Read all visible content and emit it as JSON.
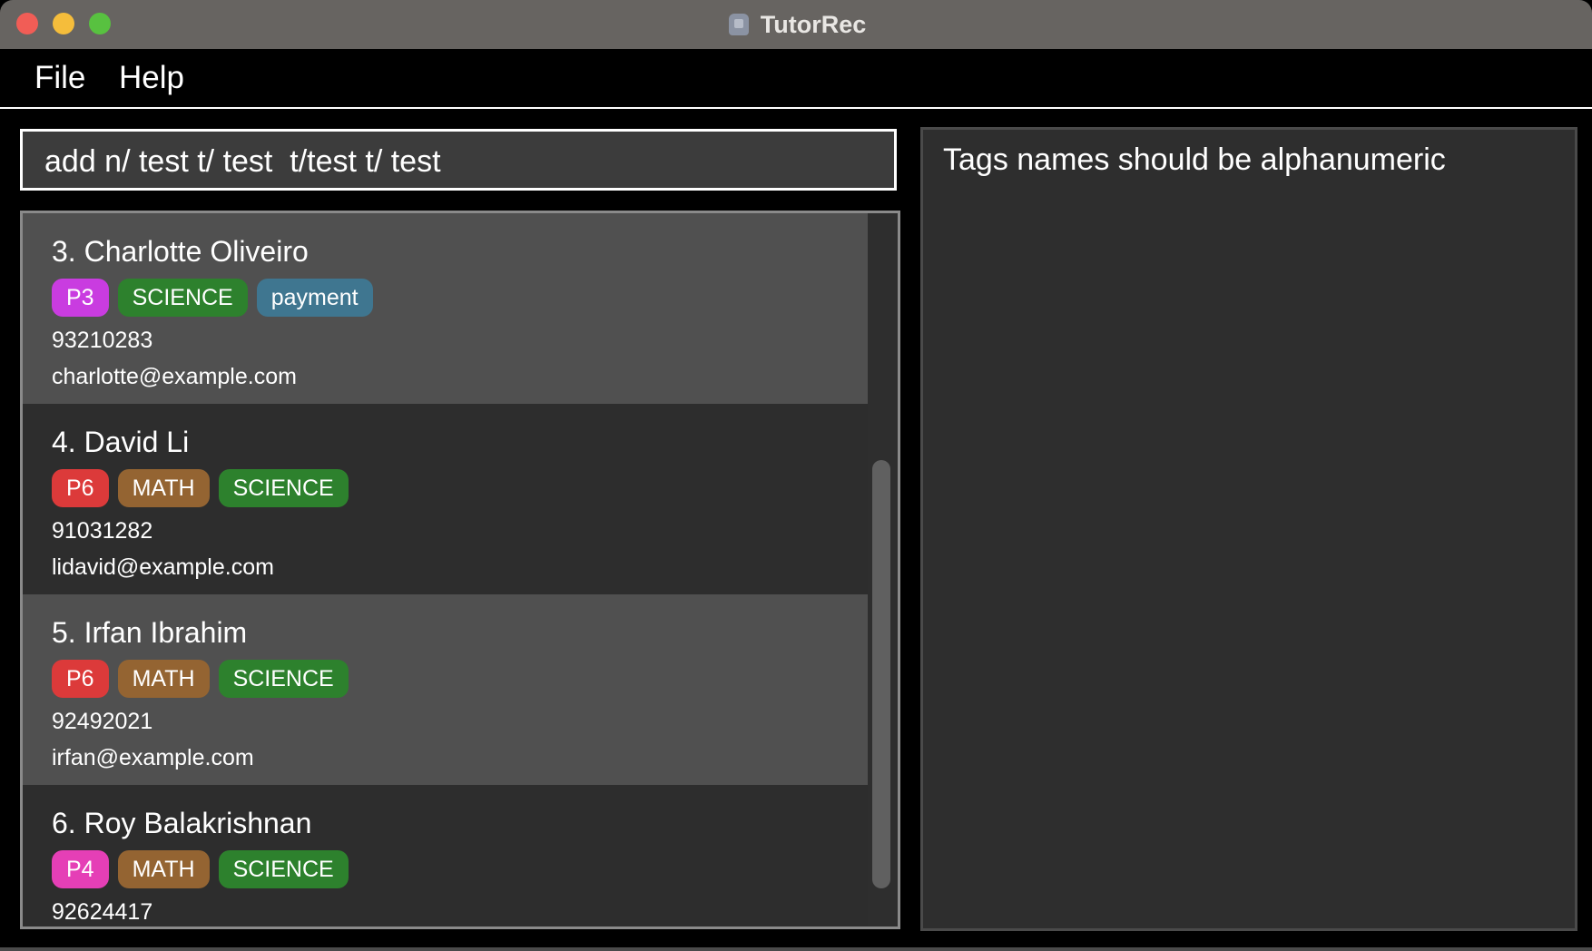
{
  "window": {
    "title": "TutorRec",
    "icon": "app-logo-icon"
  },
  "menu": {
    "file": "File",
    "help": "Help"
  },
  "command": {
    "value": "add n/ test t/ test  t/test t/ test"
  },
  "result": {
    "message": "Tags names should be alphanumeric"
  },
  "tag_colors": {
    "P3": "#c93ce0",
    "P4": "#e53fb6",
    "P6": "#dc3a3a",
    "MATH": "#946432",
    "SCIENCE": "#2d812d",
    "payment": "#3f7690"
  },
  "persons": [
    {
      "label": "3.  Charlotte Oliveiro",
      "tags": [
        "P3",
        "SCIENCE",
        "payment"
      ],
      "phone": "93210283",
      "email": "charlotte@example.com"
    },
    {
      "label": "4.  David Li",
      "tags": [
        "P6",
        "MATH",
        "SCIENCE"
      ],
      "phone": "91031282",
      "email": "lidavid@example.com"
    },
    {
      "label": "5.  Irfan Ibrahim",
      "tags": [
        "P6",
        "MATH",
        "SCIENCE"
      ],
      "phone": "92492021",
      "email": "irfan@example.com"
    },
    {
      "label": "6.  Roy Balakrishnan",
      "tags": [
        "P4",
        "MATH",
        "SCIENCE"
      ],
      "phone": "92624417",
      "email": ""
    }
  ]
}
